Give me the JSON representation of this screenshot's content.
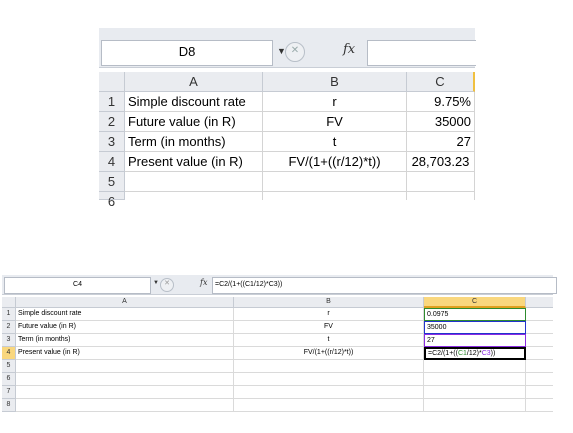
{
  "top": {
    "name_box": "D8",
    "fx_label": "fx",
    "columns": [
      "A",
      "B",
      "C"
    ],
    "rows": [
      "1",
      "2",
      "3",
      "4",
      "5",
      "6"
    ],
    "cells": [
      {
        "a": "Simple discount rate",
        "b": "r",
        "c": "9.75%"
      },
      {
        "a": "Future value (in R)",
        "b": "FV",
        "c": "35000"
      },
      {
        "a": "Term (in months)",
        "b": "t",
        "c": "27"
      },
      {
        "a": "Present value (in R)",
        "b": "FV/(1+((r/12)*t))",
        "c": "28,703.23"
      }
    ]
  },
  "bottom": {
    "name_box": "C4",
    "fx_label": "fx",
    "formula_bar": "=C2/(1+((C1/12)*C3))",
    "columns": [
      "A",
      "B",
      "C"
    ],
    "rows": [
      "1",
      "2",
      "3",
      "4",
      "5",
      "6",
      "7",
      "8"
    ],
    "cells": [
      {
        "a": "Simple discount rate",
        "b": "r",
        "c": "0.0975"
      },
      {
        "a": "Future value (in R)",
        "b": "FV",
        "c": "35000"
      },
      {
        "a": "Term (in months)",
        "b": "t",
        "c": "27"
      },
      {
        "a": "Present value (in R)",
        "b": "FV/(1+((r/12)*t))"
      }
    ],
    "c4_formula": {
      "p1": "=C2/(1+((",
      "p2": "C1",
      "p3": "/12)*",
      "p4": "C3",
      "p5": "))"
    },
    "colors": {
      "ref_c1": "#2e8b2e",
      "ref_c2": "#2233cc",
      "ref_c3": "#8a2be2",
      "active_header": "#f9d77e"
    }
  }
}
